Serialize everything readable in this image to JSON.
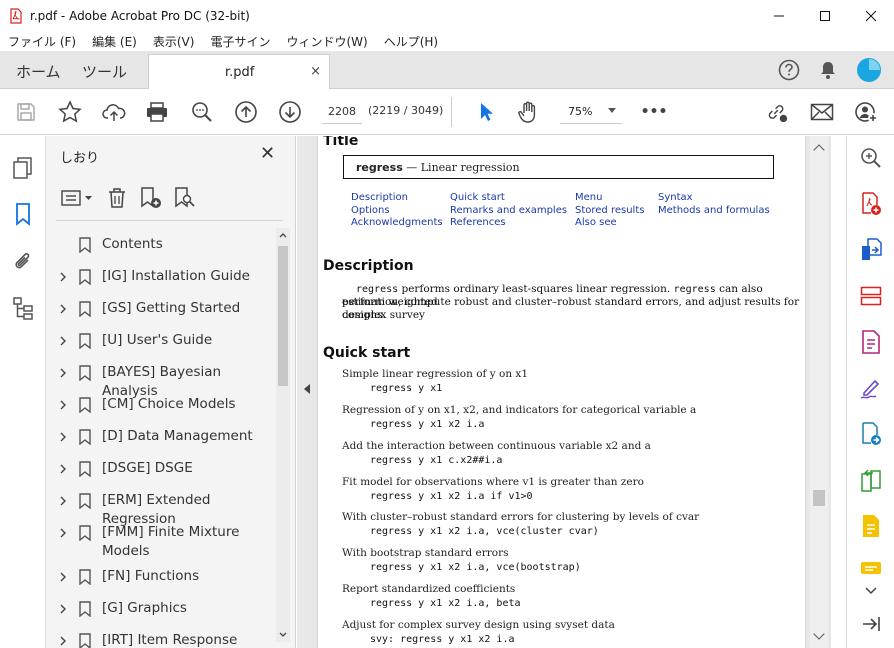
{
  "window": {
    "title": "r.pdf - Adobe Acrobat Pro DC (32-bit)",
    "minimize": "—",
    "maximize": "☐",
    "close": "✕"
  },
  "menu": [
    "ファイル (F)",
    "編集 (E)",
    "表示(V)",
    "電子サイン",
    "ウィンドウ(W)",
    "ヘルプ(H)"
  ],
  "tabs": {
    "home": "ホーム",
    "tools": "ツール",
    "doc": "r.pdf",
    "doc_close": "×"
  },
  "toolbar": {
    "page_number": "2208",
    "page_count": "(2219 / 3049)",
    "zoom": "75%",
    "more": "•••"
  },
  "bookmarks": {
    "header": "しおり",
    "close": "✕",
    "items": [
      {
        "label": "Contents",
        "expandable": false
      },
      {
        "label": "[IG] Installation Guide",
        "expandable": true
      },
      {
        "label": "[GS] Getting Started",
        "expandable": true
      },
      {
        "label": "[U] User's Guide",
        "expandable": true
      },
      {
        "label": "[BAYES] Bayesian Analysis",
        "expandable": true
      },
      {
        "label": "[CM] Choice Models",
        "expandable": true
      },
      {
        "label": "[D] Data Management",
        "expandable": true
      },
      {
        "label": "[DSGE] DSGE",
        "expandable": true
      },
      {
        "label": "[ERM] Extended Regression",
        "expandable": true
      },
      {
        "label": "[FMM] Finite Mixture Models",
        "expandable": true
      },
      {
        "label": "[FN] Functions",
        "expandable": true
      },
      {
        "label": "[G] Graphics",
        "expandable": true
      },
      {
        "label": "[IRT] Item Response Theory",
        "expandable": true
      }
    ]
  },
  "document": {
    "title_heading": "Title",
    "title_cmd": "regress",
    "title_desc": "— Linear regression",
    "links": [
      [
        "Description",
        "Options",
        "Acknowledgments"
      ],
      [
        "Quick start",
        "Remarks and examples",
        "References"
      ],
      [
        "Menu",
        "Stored results",
        "Also see"
      ],
      [
        "Syntax",
        "Methods and formulas"
      ]
    ],
    "description_heading": "Description",
    "description_code1": "regress",
    "description_text1": "performs ordinary least-squares linear regression.",
    "description_code2": "regress",
    "description_text2": "can also perform weighted",
    "description_line2": "estimation, compute robust and cluster–robust standard errors, and adjust results for complex survey",
    "description_line3": "designs.",
    "quickstart_heading": "Quick start",
    "quickstart": [
      {
        "text": "Simple linear regression of y on x1",
        "code": "regress y x1"
      },
      {
        "text": "Regression of y on x1, x2, and indicators for categorical variable a",
        "code": "regress y x1 x2 i.a"
      },
      {
        "text": "Add the interaction between continuous variable x2 and a",
        "code": "regress y x1 c.x2##i.a"
      },
      {
        "text": "Fit model for observations where v1 is greater than zero",
        "code": "regress y x1 x2 i.a if v1>0"
      },
      {
        "text": "With cluster–robust standard errors for clustering by levels of cvar",
        "code": "regress y x1 x2 i.a, vce(cluster cvar)"
      },
      {
        "text": "With bootstrap standard errors",
        "code": "regress y x1 x2 i.a, vce(bootstrap)"
      },
      {
        "text": "Report standardized coefficients",
        "code": "regress y x1 x2 i.a, beta"
      },
      {
        "text": "Adjust for complex survey design using svyset data",
        "code": "svy: regress y x1 x2 i.a"
      }
    ]
  },
  "colors": {
    "acrobat_red": "#d9221c",
    "link_blue": "#1a3aa8",
    "accent_blue": "#1473e6"
  }
}
